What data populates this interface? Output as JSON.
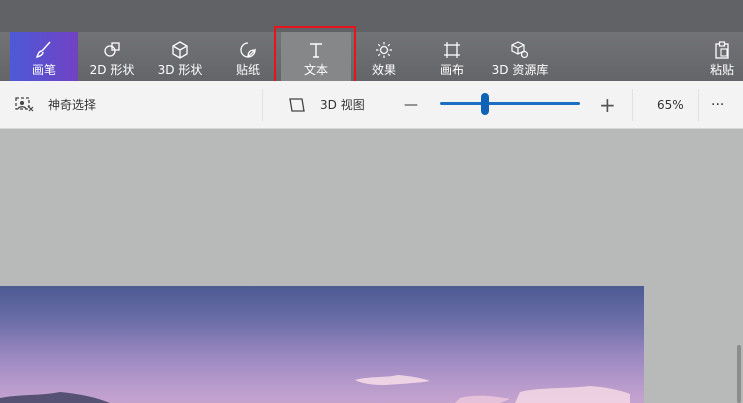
{
  "ribbon": {
    "tabs": [
      {
        "label": "画笔",
        "icon": "brush-icon",
        "state": "active"
      },
      {
        "label": "2D 形状",
        "icon": "shapes-2d-icon",
        "state": "normal"
      },
      {
        "label": "3D 形状",
        "icon": "cube-3d-icon",
        "state": "normal"
      },
      {
        "label": "贴纸",
        "icon": "sticker-icon",
        "state": "normal"
      },
      {
        "label": "文本",
        "icon": "text-icon",
        "state": "selected"
      },
      {
        "label": "效果",
        "icon": "effects-sun-icon",
        "state": "normal"
      },
      {
        "label": "画布",
        "icon": "canvas-crop-icon",
        "state": "normal"
      },
      {
        "label": "3D 资源库",
        "icon": "library-3d-icon",
        "state": "normal"
      }
    ],
    "paste": {
      "label": "粘贴",
      "icon": "clipboard-icon"
    },
    "colors": {
      "active_start": "#4d5ad6",
      "active_end": "#7042c4",
      "selected": "#868789",
      "highlight": "#e8141b"
    }
  },
  "toolbar": {
    "magic_select": {
      "label": "神奇选择",
      "icon": "magic-select-icon"
    },
    "view_3d": {
      "label": "3D 视图",
      "icon": "view-3d-icon"
    },
    "zoom": {
      "minus": "—",
      "plus": "+",
      "level": "65%",
      "level_fraction": 0.3
    },
    "more": "···"
  }
}
